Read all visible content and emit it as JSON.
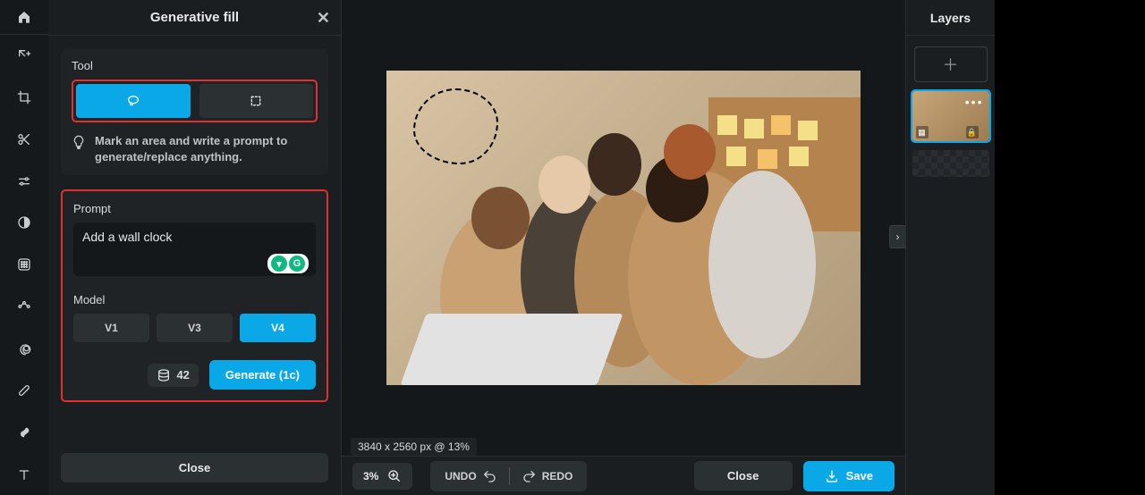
{
  "panel": {
    "title": "Generative fill",
    "tool_section": "Tool",
    "hint": "Mark an area and write a prompt to generate/replace anything.",
    "prompt_section": "Prompt",
    "prompt_value": "Add a wall clock",
    "model_section": "Model",
    "models": {
      "v1": "V1",
      "v3": "V3",
      "v4": "V4"
    },
    "credits": "42",
    "generate_label": "Generate (1c)",
    "close_label": "Close"
  },
  "canvas": {
    "dimensions": "3840 x 2560 px @ 13%"
  },
  "bottom": {
    "zoom": "3%",
    "undo": "UNDO",
    "redo": "REDO",
    "close": "Close",
    "save": "Save"
  },
  "layers": {
    "title": "Layers"
  },
  "colors": {
    "accent": "#0aa8e6",
    "highlight_border": "#e03030"
  }
}
